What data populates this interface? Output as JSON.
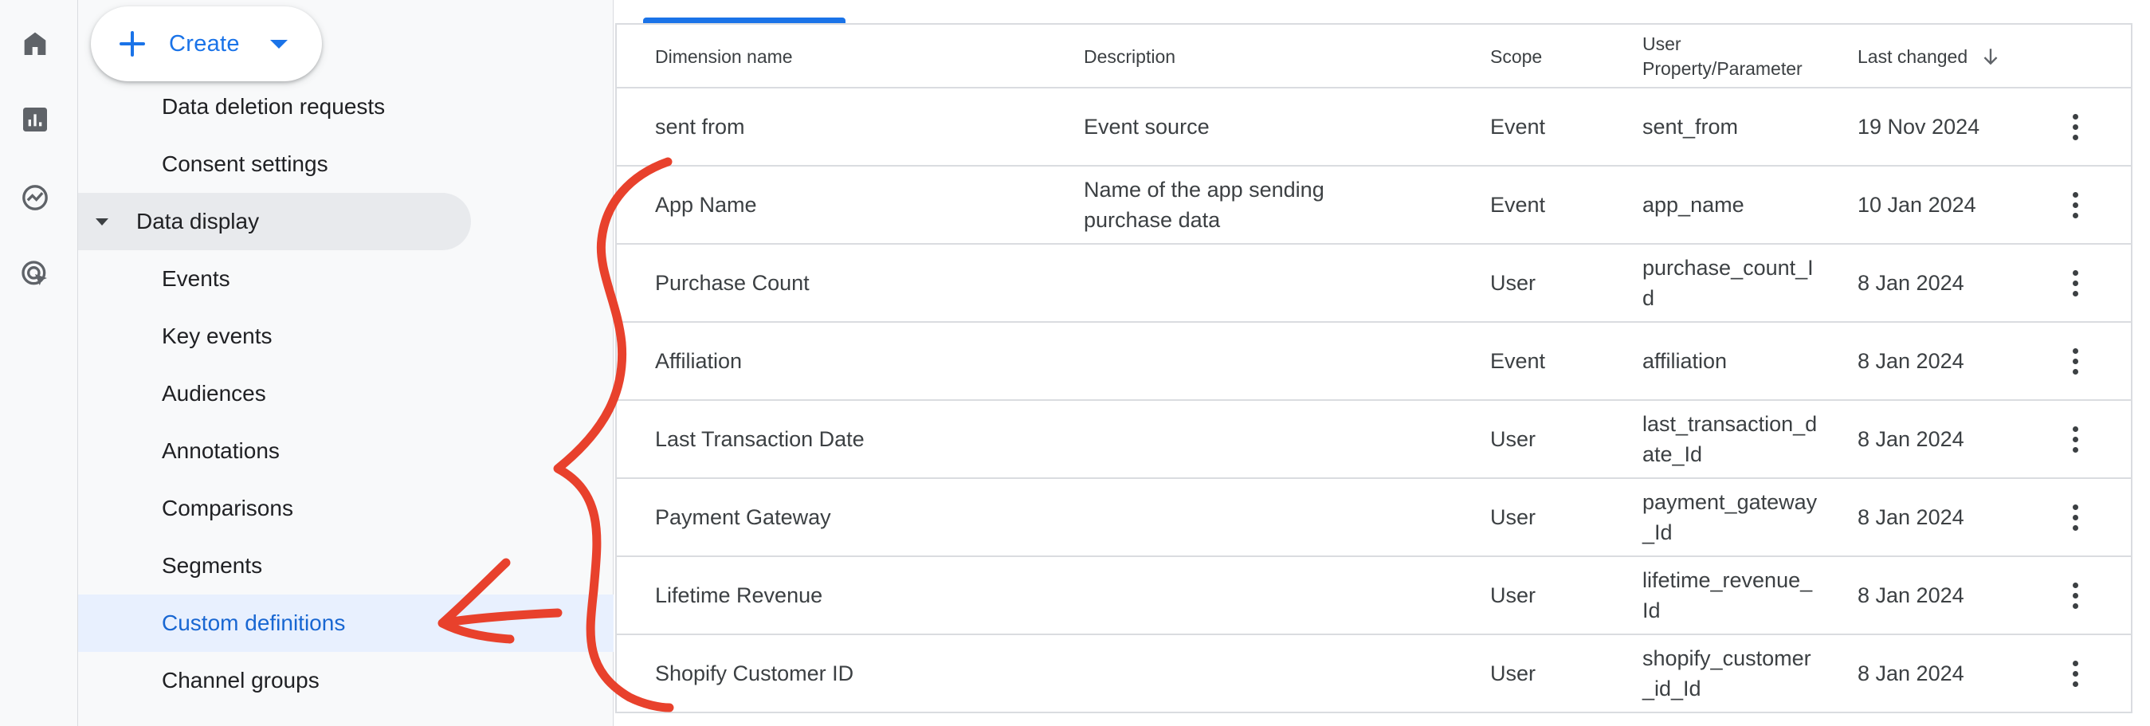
{
  "rail": {
    "icons": [
      "home-icon",
      "reports-icon",
      "explore-icon",
      "advertising-icon"
    ]
  },
  "nav": {
    "create_label": "Create",
    "items": [
      {
        "label": "Data deletion requests",
        "kind": "item"
      },
      {
        "label": "Consent settings",
        "kind": "item"
      },
      {
        "label": "Data display",
        "kind": "section"
      },
      {
        "label": "Events",
        "kind": "item"
      },
      {
        "label": "Key events",
        "kind": "item"
      },
      {
        "label": "Audiences",
        "kind": "item"
      },
      {
        "label": "Annotations",
        "kind": "item"
      },
      {
        "label": "Comparisons",
        "kind": "item"
      },
      {
        "label": "Segments",
        "kind": "item"
      },
      {
        "label": "Custom definitions",
        "kind": "active"
      },
      {
        "label": "Channel groups",
        "kind": "item"
      }
    ]
  },
  "table": {
    "headers": {
      "name": "Dimension name",
      "description": "Description",
      "scope": "Scope",
      "param": "User Property/Parameter",
      "last_changed": "Last changed"
    },
    "sort": "descending",
    "rows": [
      {
        "name": "sent from",
        "description": "Event source",
        "scope": "Event",
        "param": "sent_from",
        "date": "19 Nov 2024"
      },
      {
        "name": "App Name",
        "description": "Name of the app sending purchase data",
        "scope": "Event",
        "param": "app_name",
        "date": "10 Jan 2024"
      },
      {
        "name": "Purchase Count",
        "description": "",
        "scope": "User",
        "param": "purchase_count_Id",
        "date": "8 Jan 2024"
      },
      {
        "name": "Affiliation",
        "description": "",
        "scope": "Event",
        "param": "affiliation",
        "date": "8 Jan 2024"
      },
      {
        "name": "Last Transaction Date",
        "description": "",
        "scope": "User",
        "param": "last_transaction_date_Id",
        "date": "8 Jan 2024"
      },
      {
        "name": "Payment Gateway",
        "description": "",
        "scope": "User",
        "param": "payment_gateway_Id",
        "date": "8 Jan 2024"
      },
      {
        "name": "Lifetime Revenue",
        "description": "",
        "scope": "User",
        "param": "lifetime_revenue_Id",
        "date": "8 Jan 2024"
      },
      {
        "name": "Shopify Customer ID",
        "description": "",
        "scope": "User",
        "param": "shopify_customer_id_Id",
        "date": "8 Jan 2024"
      }
    ]
  },
  "colors": {
    "accent": "#1a73e8",
    "active_bg": "#e8f0fe",
    "annotation": "#e8412c"
  }
}
